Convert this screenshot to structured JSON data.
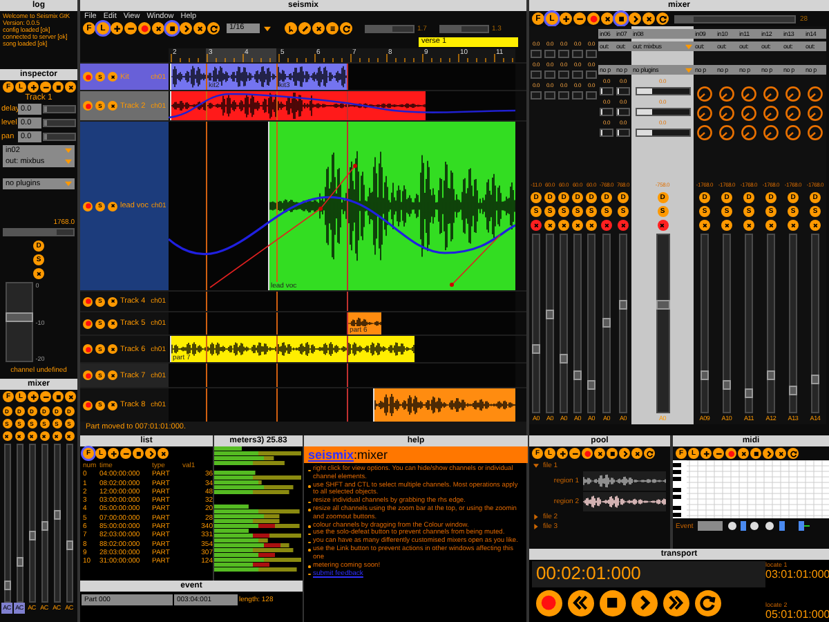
{
  "log": {
    "title": "log",
    "lines": [
      "Welcome to Seismix GtK",
      "Version: 0.0.5",
      "config loaded [ok]",
      "connected to server [ok]",
      "song loaded [ok]"
    ]
  },
  "inspector": {
    "title": "inspector",
    "toolbar": [
      {
        "kind": "letter",
        "label": "F",
        "selected": false
      },
      {
        "kind": "letter",
        "label": "L",
        "selected": false
      },
      {
        "kind": "plus",
        "selected": false
      },
      {
        "kind": "minus",
        "selected": false
      },
      {
        "kind": "stop",
        "selected": false
      },
      {
        "kind": "close",
        "selected": false
      }
    ],
    "track": "Track 1",
    "params": [
      {
        "label": "delay",
        "value": "0.0",
        "level": 0.1
      },
      {
        "label": "level",
        "value": "0.0",
        "level": 0.1
      },
      {
        "label": "pan",
        "value": "0.0",
        "level": 0.1
      }
    ],
    "input": "in02",
    "output": "out: mixbus",
    "plugins": "no plugins",
    "gain": {
      "reading": "1768.0",
      "level": 0.75
    },
    "buttons": [
      "D",
      "S"
    ],
    "muted": false,
    "fader": {
      "level": 0.55,
      "scale": [
        "0",
        "-10",
        "-20"
      ]
    },
    "status": "channel undefined"
  },
  "small_mixer": {
    "title": "mixer",
    "toolbar": [
      {
        "kind": "letter",
        "label": "F",
        "selected": false
      },
      {
        "kind": "letter",
        "label": "L",
        "selected": false
      },
      {
        "kind": "plus",
        "selected": false
      },
      {
        "kind": "minus",
        "selected": false
      },
      {
        "kind": "stop",
        "selected": false
      },
      {
        "kind": "close",
        "selected": false
      }
    ],
    "strips": [
      {
        "buttons": [
          "D",
          "S"
        ],
        "muted": false,
        "level": 0.1,
        "label": "AC",
        "selected": true
      },
      {
        "buttons": [
          "D",
          "S"
        ],
        "muted": false,
        "level": 0.25,
        "label": "AC",
        "selected": true
      },
      {
        "buttons": [
          "D",
          "S"
        ],
        "muted": false,
        "level": 0.42,
        "label": "AC",
        "selected": false
      },
      {
        "buttons": [
          "D",
          "S"
        ],
        "muted": false,
        "level": 0.48,
        "label": "AC",
        "selected": false
      },
      {
        "buttons": [
          "D",
          "S"
        ],
        "muted": false,
        "level": 0.55,
        "label": "AC",
        "selected": false
      },
      {
        "buttons": [
          "D",
          "S"
        ],
        "muted": false,
        "level": 0.35,
        "label": "AC",
        "selected": false
      }
    ]
  },
  "seismix": {
    "title": "seismix",
    "menu": [
      "File",
      "Edit",
      "View",
      "Window",
      "Help"
    ],
    "toolbar": [
      {
        "kind": "letter",
        "label": "F",
        "selected": false
      },
      {
        "kind": "letter",
        "label": "L",
        "selected": true
      },
      {
        "kind": "plus",
        "selected": false
      },
      {
        "kind": "minus",
        "selected": false
      },
      {
        "kind": "record",
        "selected": false
      },
      {
        "kind": "close",
        "selected": false
      },
      {
        "kind": "stop",
        "selected": true
      },
      {
        "kind": "play",
        "selected": false
      },
      {
        "kind": "close",
        "selected": false
      },
      {
        "kind": "loop",
        "selected": false
      }
    ],
    "quantize": "1/16",
    "tools": [
      {
        "kind": "pointer",
        "selected": false
      },
      {
        "kind": "pencil",
        "selected": false
      },
      {
        "kind": "close",
        "selected": false
      },
      {
        "kind": "menu",
        "selected": false
      },
      {
        "kind": "loop",
        "selected": false
      }
    ],
    "zoom": [
      {
        "reading": "1.7",
        "level": 0.55
      },
      {
        "reading": "1.3",
        "level": 0.45
      }
    ],
    "marker": "verse 1",
    "ruler": [
      "2",
      "3",
      "4",
      "5",
      "6",
      "7",
      "8",
      "9",
      "10",
      "11"
    ],
    "tracks": [
      {
        "name": "Kit",
        "channel": "ch01",
        "color": "#6860d8",
        "solo": "S",
        "muted": false,
        "parts": [
          {
            "color": "#7474f0"
          },
          {
            "label": "kit2",
            "color": "#7474f0"
          },
          {
            "label": "kit3",
            "color": "#7474f0"
          }
        ]
      },
      {
        "name": "Track 2",
        "channel": "ch01",
        "color": "#6e6e6e",
        "solo": "S",
        "muted": false,
        "parts": [
          {
            "color": "#ff1a1a"
          }
        ]
      },
      {
        "name": "lead voc",
        "channel": "ch01",
        "color": "#1c3c7c",
        "solo": "S",
        "muted": false,
        "parts": [
          {
            "label": "lead voc",
            "color": "#33dd22"
          }
        ]
      },
      {
        "name": "Track 4",
        "channel": "ch01",
        "color": "#111111",
        "solo": "S",
        "muted": false
      },
      {
        "name": "Track 5",
        "channel": "ch01",
        "color": "#111111",
        "solo": "S",
        "muted": false,
        "parts": [
          {
            "label": "part 6",
            "color": "#ff8c10"
          }
        ]
      },
      {
        "name": "Track 6",
        "channel": "ch01",
        "color": "#111111",
        "solo": "S",
        "muted": false,
        "parts": [
          {
            "label": "part 7",
            "color": "#ffee00"
          }
        ]
      },
      {
        "name": "Track 7",
        "channel": "ch01",
        "color": "#242424",
        "solo": "S",
        "muted": false
      },
      {
        "name": "Track 8",
        "channel": "ch01",
        "color": "#111111",
        "solo": "S",
        "muted": false,
        "parts": [
          {
            "color": "#ff8c10"
          }
        ]
      }
    ],
    "status": "Part moved to 007:01:01:000."
  },
  "mixer": {
    "title": "mixer",
    "toolbar": [
      {
        "kind": "letter",
        "label": "F",
        "selected": false
      },
      {
        "kind": "letter",
        "label": "L",
        "selected": true
      },
      {
        "kind": "plus",
        "selected": false
      },
      {
        "kind": "minus",
        "selected": false
      },
      {
        "kind": "record",
        "selected": false
      },
      {
        "kind": "close",
        "selected": false
      },
      {
        "kind": "stop",
        "selected": true
      },
      {
        "kind": "play",
        "selected": false
      },
      {
        "kind": "close",
        "selected": false
      },
      {
        "kind": "loop",
        "selected": false
      }
    ],
    "zoom": {
      "reading": "28",
      "level": 0.15
    },
    "strips": [
      {
        "kind": "compact",
        "sends": [
          {
            "reading": "0.0"
          },
          {
            "reading": "0.0"
          },
          {
            "reading": "0.0"
          }
        ],
        "gain": "-11.0",
        "buttons": [
          "D",
          "S"
        ],
        "muted": true,
        "level": 0.35,
        "label": "A0",
        "selected": false
      },
      {
        "kind": "compact",
        "sends": [
          {
            "reading": "0.0"
          },
          {
            "reading": "0.0"
          },
          {
            "reading": "0.0"
          }
        ],
        "gain": "60.0",
        "buttons": [
          "D",
          "S"
        ],
        "muted": false,
        "level": 0.55,
        "label": "A0",
        "selected": false
      },
      {
        "kind": "compact",
        "sends": [
          {
            "reading": "0.0"
          },
          {
            "reading": "0.0"
          },
          {
            "reading": "0.0"
          }
        ],
        "gain": "60.0",
        "buttons": [
          "D",
          "S"
        ],
        "muted": false,
        "level": 0.3,
        "label": "A0",
        "selected": false
      },
      {
        "kind": "compact",
        "sends": [
          {
            "reading": "0.0"
          },
          {
            "reading": "0.0"
          },
          {
            "reading": "0.0"
          }
        ],
        "gain": "60.0",
        "buttons": [
          "D",
          "S"
        ],
        "muted": false,
        "level": 0.2,
        "label": "A0",
        "selected": false
      },
      {
        "kind": "compact",
        "sends": [
          {
            "reading": "0.0"
          },
          {
            "reading": "0.0"
          },
          {
            "reading": "0.0"
          }
        ],
        "gain": "60.0",
        "buttons": [
          "D",
          "S"
        ],
        "muted": false,
        "level": 0.15,
        "label": "A0",
        "selected": false
      },
      {
        "kind": "panel",
        "name": "in06",
        "out": "out:",
        "plugins": "no p",
        "sends": [
          {
            "reading": "0.0",
            "level": 0.1
          },
          {
            "reading": "0.0",
            "level": 0.1
          },
          {
            "reading": "0.0",
            "level": 0.1
          }
        ],
        "gain": "-768.0",
        "buttons": [
          "D",
          "S"
        ],
        "muted": true,
        "level": 0.5,
        "label": "A0",
        "selected": false
      },
      {
        "kind": "panel",
        "name": "in07",
        "out": "out:",
        "plugins": "no p",
        "sends": [
          {
            "reading": "0.0",
            "level": 0.1
          },
          {
            "reading": "0.0",
            "level": 0.1
          },
          {
            "reading": "0.0",
            "level": 0.1
          }
        ],
        "gain": "768.0",
        "buttons": [
          "D",
          "S"
        ],
        "muted": true,
        "level": 0.6,
        "label": "A0",
        "selected": false
      },
      {
        "kind": "wide",
        "name": "in08",
        "out": "out: mixbus",
        "plugins": "no plugins",
        "sends": [
          {
            "reading": "0.0",
            "level": 0.3
          },
          {
            "reading": "0.0",
            "level": 0.3
          },
          {
            "reading": "0.0",
            "level": 0.3
          }
        ],
        "gain": "-758.0",
        "buttons": [
          "D",
          "S"
        ],
        "muted": true,
        "level": 0.6,
        "label": "A0",
        "selected": true
      },
      {
        "kind": "knob",
        "name": "in09",
        "out": "out:",
        "plugins": "no p",
        "gain": "-1768.0",
        "buttons": [
          "D",
          "S"
        ],
        "muted": false,
        "level": 0.2,
        "label": "A09",
        "selected": false
      },
      {
        "kind": "knob",
        "name": "in10",
        "out": "out:",
        "plugins": "no p",
        "gain": "-1768.0",
        "buttons": [
          "D",
          "S"
        ],
        "muted": false,
        "level": 0.15,
        "label": "A10",
        "selected": false
      },
      {
        "kind": "knob",
        "name": "in11",
        "out": "out:",
        "plugins": "no p",
        "gain": "-1768.0",
        "buttons": [
          "D",
          "S"
        ],
        "muted": false,
        "level": 0.1,
        "label": "A11",
        "selected": false
      },
      {
        "kind": "knob",
        "name": "in12",
        "out": "out:",
        "plugins": "no p",
        "gain": "-1768.0",
        "buttons": [
          "D",
          "S"
        ],
        "muted": false,
        "level": 0.2,
        "label": "A12",
        "selected": false
      },
      {
        "kind": "knob",
        "name": "in13",
        "out": "out:",
        "plugins": "no p",
        "gain": "-1768.0",
        "buttons": [
          "D",
          "S"
        ],
        "muted": false,
        "level": 0.12,
        "label": "A13",
        "selected": false
      },
      {
        "kind": "knob",
        "name": "in14",
        "out": "out:",
        "plugins": "no p",
        "gain": "-1768.0",
        "buttons": [
          "D",
          "S"
        ],
        "muted": false,
        "level": 0.18,
        "label": "A14",
        "selected": false
      }
    ]
  },
  "list": {
    "title": "list",
    "toolbar": [
      {
        "kind": "letter",
        "label": "F",
        "selected": true
      },
      {
        "kind": "letter",
        "label": "L",
        "selected": false
      },
      {
        "kind": "plus",
        "selected": false
      },
      {
        "kind": "minus",
        "selected": false
      },
      {
        "kind": "stop",
        "selected": false
      },
      {
        "kind": "play",
        "selected": false
      },
      {
        "kind": "close",
        "selected": false
      }
    ],
    "columns": [
      "num",
      "time",
      "type",
      "val1"
    ],
    "rows": [
      [
        "0",
        "04:00:00:000",
        "PART",
        "36"
      ],
      [
        "1",
        "08:02:00:000",
        "PART",
        "34"
      ],
      [
        "2",
        "12:00:00:000",
        "PART",
        "48"
      ],
      [
        "3",
        "03:00:00:000",
        "PART",
        "32"
      ],
      [
        "4",
        "05:00:00:000",
        "PART",
        "20"
      ],
      [
        "5",
        "07:00:00:000",
        "PART",
        "28"
      ],
      [
        "6",
        "85:00:00:000",
        "PART",
        "340"
      ],
      [
        "7",
        "82:03:00:000",
        "PART",
        "331"
      ],
      [
        "8",
        "88:02:00:000",
        "PART",
        "354"
      ],
      [
        "9",
        "28:03:00:000",
        "PART",
        "307"
      ],
      [
        "10",
        "31:00:00:000",
        "PART",
        "124"
      ]
    ]
  },
  "event": {
    "title": "event",
    "fields": [
      "Part 000",
      "003:04:001"
    ],
    "length": "length: 128"
  },
  "meters": {
    "title": "meters3) 25.83"
  },
  "help": {
    "title": "help",
    "link": "seismix",
    "heading": ":mixer",
    "items": [
      "right click for view options. You can hide/show channels or individual channel elements.",
      "use SHFT and CTL to select multiple channels. Most operations apply to all selected objects.",
      "resize individual channels by grabbing the rhs edge.",
      "resize all channels using the zoom bar at the top, or using the zoomin and zoomout buttons.",
      "colour channels by dragging from the Colour window.",
      "use the solo-defeat button to prevent channels from being muted.",
      "you can have as many differently customised mixers open as you like.",
      "use the Link button to prevent actions in other windows affecting this one",
      "metering coming soon!"
    ],
    "feedback": "submit feedback"
  },
  "pool": {
    "title": "pool",
    "toolbar": [
      {
        "kind": "letter",
        "label": "F",
        "selected": false
      },
      {
        "kind": "letter",
        "label": "L",
        "selected": false
      },
      {
        "kind": "plus",
        "selected": false
      },
      {
        "kind": "minus",
        "selected": false
      },
      {
        "kind": "record",
        "selected": false
      },
      {
        "kind": "close",
        "selected": false
      },
      {
        "kind": "stop",
        "selected": false
      },
      {
        "kind": "play",
        "selected": false
      },
      {
        "kind": "close",
        "selected": false
      },
      {
        "kind": "loop",
        "selected": false
      }
    ],
    "files": [
      {
        "label": "file 1",
        "expanded": true,
        "children": [
          {
            "label": "region 1",
            "selected": false
          },
          {
            "label": "region 2",
            "selected": true
          }
        ]
      },
      {
        "label": "file 2",
        "expanded": false
      },
      {
        "label": "file 3",
        "expanded": false
      }
    ]
  },
  "midi": {
    "title": "midi",
    "toolbar": [
      {
        "kind": "letter",
        "label": "F",
        "selected": false
      },
      {
        "kind": "letter",
        "label": "L",
        "selected": false
      },
      {
        "kind": "plus",
        "selected": false
      },
      {
        "kind": "minus",
        "selected": false
      },
      {
        "kind": "record",
        "selected": false
      },
      {
        "kind": "close",
        "selected": false
      },
      {
        "kind": "stop",
        "selected": false
      },
      {
        "kind": "play",
        "selected": false
      },
      {
        "kind": "close",
        "selected": false
      },
      {
        "kind": "loop",
        "selected": false
      }
    ],
    "event_label": "Event"
  },
  "transport": {
    "title": "transport",
    "time": "00:02:01:000",
    "locates": [
      {
        "label": "locate 1",
        "time": "03:01:01:000"
      },
      {
        "label": "locate 2",
        "time": "05:01:01:000"
      }
    ],
    "buttons": [
      {
        "kind": "record",
        "selected": false
      },
      {
        "kind": "rewind",
        "selected": false
      },
      {
        "kind": "stop",
        "selected": false
      },
      {
        "kind": "play",
        "selected": false
      },
      {
        "kind": "forward",
        "selected": false
      },
      {
        "kind": "loop",
        "selected": false
      }
    ]
  }
}
